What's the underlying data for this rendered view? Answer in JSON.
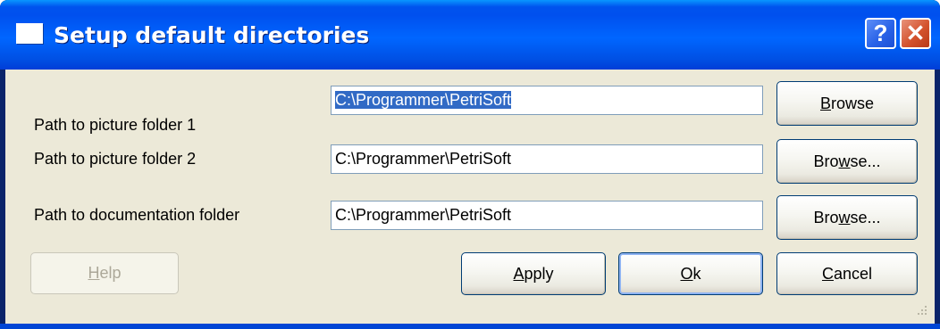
{
  "window": {
    "title": "Setup default directories",
    "help_glyph": "?",
    "close_glyph": "✕"
  },
  "rows": [
    {
      "label": "Path to picture folder  1",
      "value": "C:\\Programmer\\PetriSoft",
      "selected": true,
      "browse_mnemonic": "B",
      "browse_rest": "rowse"
    },
    {
      "label": "Path to picture folder  2",
      "value": "C:\\Programmer\\PetriSoft",
      "selected": false,
      "browse_pre": "Bro",
      "browse_mnemonic": "w",
      "browse_rest": "se..."
    },
    {
      "label": "Path to documentation folder",
      "value": "C:\\Programmer\\PetriSoft",
      "selected": false,
      "browse_pre": "Bro",
      "browse_mnemonic": "w",
      "browse_rest": "se..."
    }
  ],
  "buttons": {
    "help": {
      "mnemonic": "H",
      "rest": "elp",
      "enabled": false
    },
    "apply": {
      "mnemonic": "A",
      "rest": "pply"
    },
    "ok": {
      "mnemonic": "O",
      "rest": "k"
    },
    "cancel": {
      "mnemonic": "C",
      "rest": "ancel"
    }
  },
  "colors": {
    "titlebar": "#0055e5",
    "dialog_face": "#ece9d8",
    "selection": "#316ac5",
    "close_button": "#d4532e"
  }
}
